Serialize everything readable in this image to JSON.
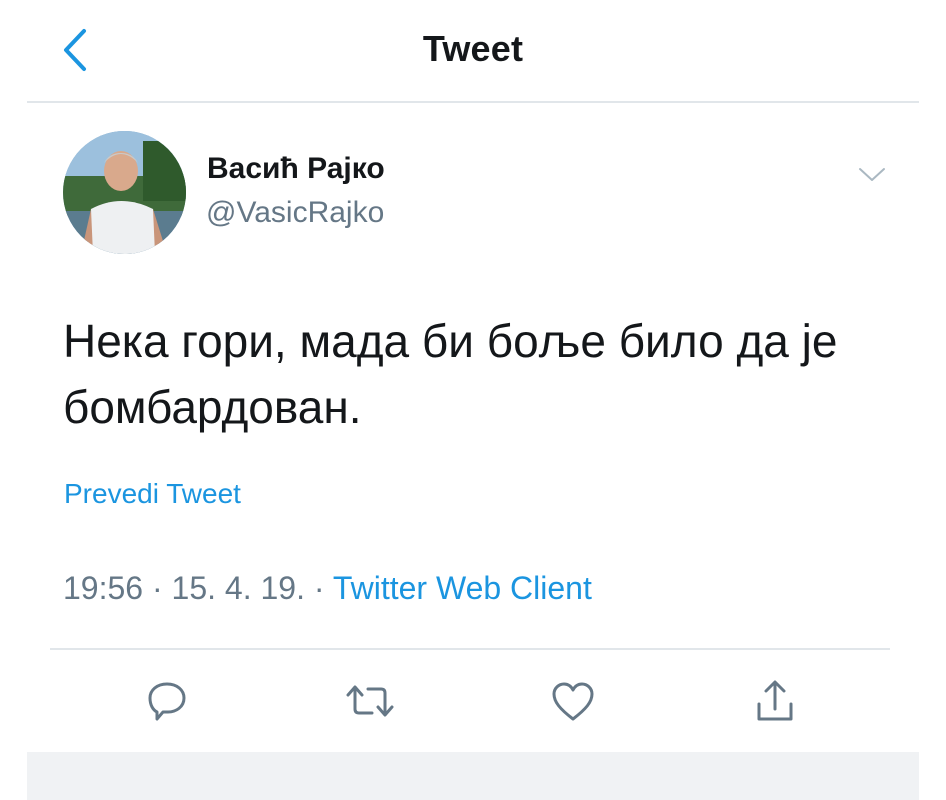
{
  "header": {
    "title": "Tweet",
    "back_icon": "chevron-left-icon"
  },
  "tweet": {
    "author_name": "Васић Рајко",
    "author_handle": "@VasicRajko",
    "text_line1": "Нека гори, мада би боље било да је",
    "text_line2": "бомбардован.",
    "translate_label": "Prevedi Tweet",
    "time": "19:56",
    "separator": "·",
    "date": "15. 4. 19.",
    "source": "Twitter Web Client"
  },
  "actions": [
    {
      "icon": "reply-icon"
    },
    {
      "icon": "retweet-icon"
    },
    {
      "icon": "like-icon"
    },
    {
      "icon": "share-icon"
    }
  ],
  "colors": {
    "accent": "#1b95e0",
    "text": "#14171a",
    "secondary": "#657786",
    "divider": "#e1e6ea"
  }
}
